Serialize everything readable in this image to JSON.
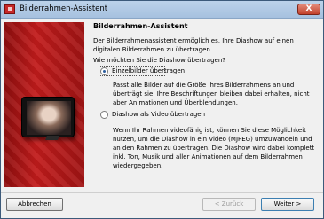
{
  "window": {
    "title": "Bilderrahmen-Assistent",
    "close_label": "X"
  },
  "main": {
    "heading": "Bilderrahmen-Assistent",
    "intro": "Der Bilderrahmenassistent ermöglich es, Ihre Diashow auf einen digitalen Bilderrahmen zu übertragen.",
    "question": "Wie möchten Sie die Diashow übertragen?",
    "options": [
      {
        "label": "Einzelbilder übertragen",
        "checked": true,
        "description": "Passt alle Bilder auf die Größe Ihres Bilderrahmens an und überträgt sie. Ihre Beschriftungen bleiben dabei erhalten, nicht aber Animationen und Überblendungen."
      },
      {
        "label": "Diashow als Video übertragen",
        "checked": false,
        "description": "Wenn Ihr Rahmen videofähig ist, können Sie diese Möglichkeit nutzen, um die Diashow in ein Video (MJPEG) umzuwandeln und an den Rahmen zu übertragen. Die Diashow wird dabei komplett inkl. Ton, Musik und aller Animationen auf dem Bilderrahmen wiedergegeben."
      }
    ]
  },
  "footer": {
    "cancel_label": "Abbrechen",
    "back_label": "< Zurück",
    "next_label": "Weiter >"
  }
}
